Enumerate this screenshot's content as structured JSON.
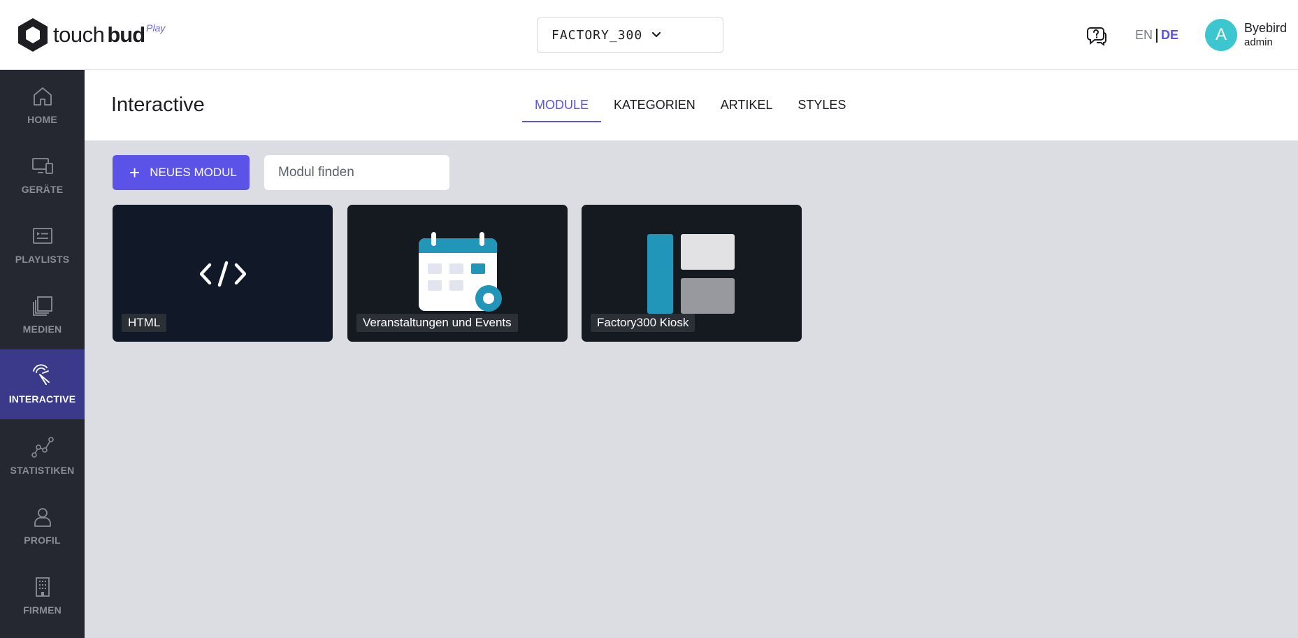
{
  "header": {
    "logo": {
      "touch": "touch",
      "bud": "bud",
      "play": "Play"
    },
    "factory_select": {
      "value": "FACTORY_300"
    },
    "language": {
      "en": "EN",
      "de": "DE",
      "active": "DE"
    },
    "user": {
      "initial": "A",
      "name": "Byebird",
      "role": "admin"
    }
  },
  "sidebar": {
    "items": [
      {
        "label": "HOME",
        "icon": "home-icon"
      },
      {
        "label": "GERÄTE",
        "icon": "devices-icon"
      },
      {
        "label": "PLAYLISTS",
        "icon": "playlist-icon"
      },
      {
        "label": "MEDIEN",
        "icon": "media-icon"
      },
      {
        "label": "INTERACTIVE",
        "icon": "touch-icon",
        "active": true
      },
      {
        "label": "STATISTIKEN",
        "icon": "stats-icon"
      },
      {
        "label": "PROFIL",
        "icon": "profile-icon"
      },
      {
        "label": "FIRMEN",
        "icon": "building-icon"
      }
    ]
  },
  "page": {
    "title": "Interactive",
    "tabs": [
      {
        "label": "MODULE",
        "active": true
      },
      {
        "label": "KATEGORIEN"
      },
      {
        "label": "ARTIKEL"
      },
      {
        "label": "STYLES"
      }
    ]
  },
  "toolbar": {
    "new_module_label": "NEUES MODUL",
    "search_placeholder": "Modul finden"
  },
  "modules": [
    {
      "label": "HTML",
      "icon": "code-icon"
    },
    {
      "label": "Veranstaltungen und Events",
      "icon": "calendar-icon"
    },
    {
      "label": "Factory300 Kiosk",
      "icon": "kiosk-layout-icon"
    }
  ],
  "colors": {
    "accent": "#5b53e8",
    "sidebar_bg": "#252830",
    "sidebar_active": "#3b3a8a",
    "avatar": "#3cc6cf",
    "teal": "#2196b8"
  }
}
